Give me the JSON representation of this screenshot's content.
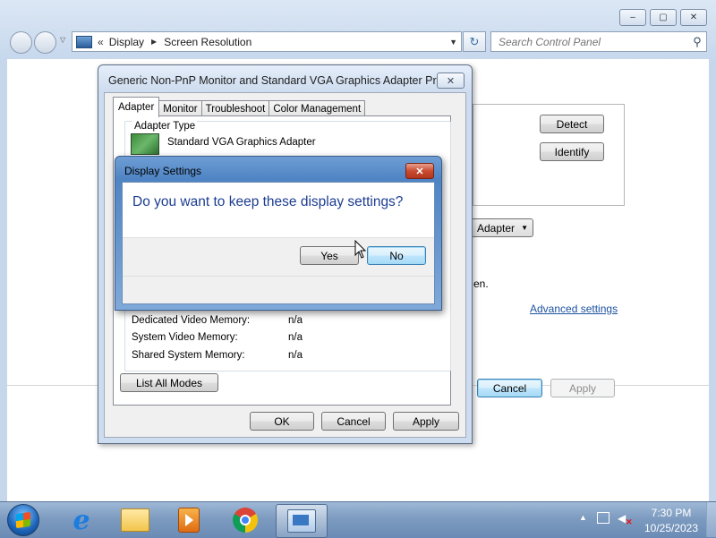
{
  "explorer": {
    "address": {
      "chevron": "«",
      "segments": [
        "Display",
        "Screen Resolution"
      ]
    },
    "search_placeholder": "Search Control Panel",
    "caption_buttons": {
      "minimize": "–",
      "maximize": "▢",
      "close": "✕"
    },
    "background": {
      "detect_label": "Detect",
      "identify_label": "Identify",
      "combo_text": "Adapter",
      "partial_text": "en.",
      "advanced_link": "Advanced settings",
      "cancel_label": "Cancel",
      "apply_label": "Apply"
    }
  },
  "properties_dialog": {
    "title": "Generic Non-PnP Monitor and Standard VGA Graphics Adapter Pro...",
    "tabs": [
      "Adapter",
      "Monitor",
      "Troubleshoot",
      "Color Management"
    ],
    "active_tab": "Adapter",
    "adapter_type_label": "Adapter Type",
    "adapter_name": "Standard VGA Graphics Adapter",
    "info_rows": [
      {
        "label": "Dedicated Video Memory:",
        "value": "n/a"
      },
      {
        "label": "System Video Memory:",
        "value": "n/a"
      },
      {
        "label": "Shared System Memory:",
        "value": "n/a"
      }
    ],
    "list_all_modes_label": "List All Modes",
    "ok_label": "OK",
    "cancel_label": "Cancel",
    "apply_label": "Apply"
  },
  "display_settings_dialog": {
    "title": "Display Settings",
    "question": "Do you want to keep these display settings?",
    "yes_label": "Yes",
    "no_label": "No"
  },
  "taskbar": {
    "apps": [
      "start-orb",
      "internet-explorer-icon",
      "file-explorer-icon",
      "media-player-icon",
      "chrome-icon",
      "control-panel-icon"
    ],
    "clock_time": "7:30 PM",
    "clock_date": "10/25/2023"
  }
}
